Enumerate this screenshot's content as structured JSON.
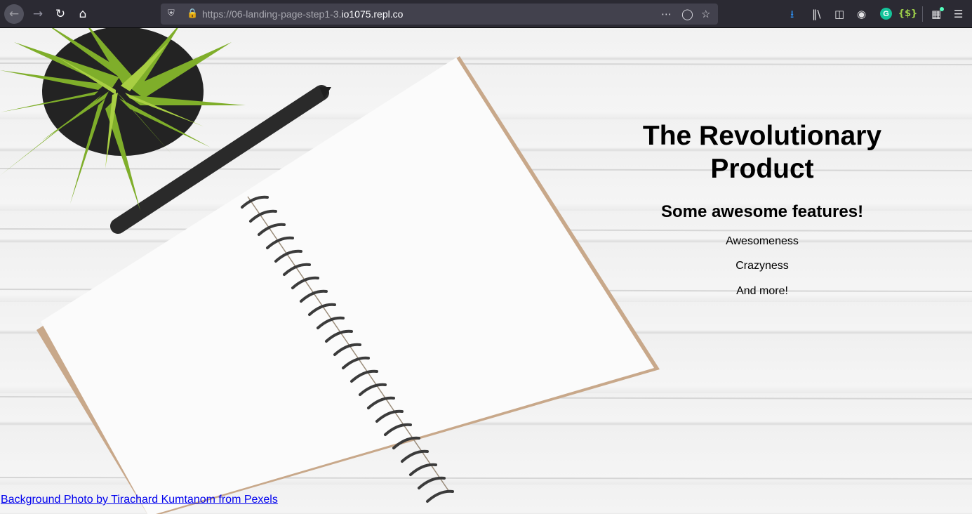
{
  "browser": {
    "url_prefix": "https://06-landing-page-step1-3.",
    "url_host": "io1075.repl.co",
    "icons": [
      "back-icon",
      "forward-icon",
      "reload-icon",
      "home-icon",
      "shield-icon",
      "lock-icon",
      "more-icon",
      "pocket-icon",
      "bookmark-star-icon",
      "download-icon",
      "library-icon",
      "sidebar-icon",
      "account-icon",
      "grammarly-icon",
      "extension-icon",
      "extensions-icon",
      "menu-icon"
    ],
    "grammarly_letter": "G",
    "extension_letter": "{$}"
  },
  "page": {
    "title": "The Revolutionary Product",
    "subtitle": "Some awesome features!",
    "features": [
      "Awesomeness",
      "Crazyness",
      "And more!"
    ],
    "credit_link": "Background Photo by Tirachard Kumtanom from Pexels"
  },
  "colors": {
    "toolbar_bg": "#2b2a33",
    "urlbar_bg": "#42414d",
    "link": "#0000ee",
    "download_accent": "#2f97ff",
    "grammarly": "#15c39a"
  }
}
